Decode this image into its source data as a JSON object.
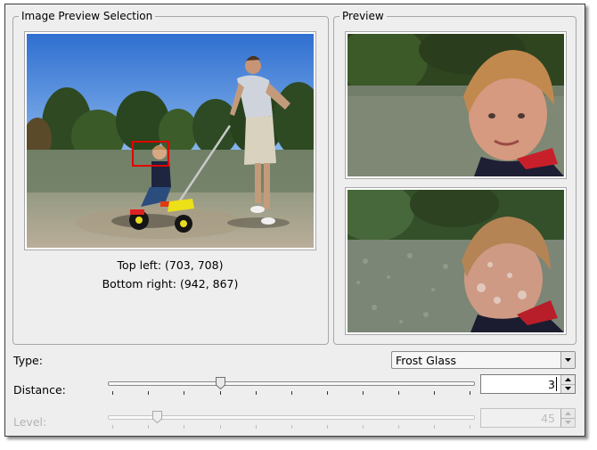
{
  "selection_panel": {
    "title": "Image Preview Selection",
    "top_left": "Top left: (703, 708)",
    "bottom_right": "Bottom right: (942, 867)"
  },
  "preview_panel": {
    "title": "Preview"
  },
  "controls": {
    "type_label": "Type:",
    "type_value": "Frost Glass",
    "distance_label": "Distance:",
    "distance_value": "3",
    "level_label": "Level:",
    "level_value": "45"
  },
  "icons": {
    "combo_arrow": "chevron-down-icon",
    "spin_up": "spin-up-icon",
    "spin_down": "spin-down-icon"
  },
  "colors": {
    "selection_rect": "#e00000",
    "dialog_bg": "#eeeeee",
    "disabled_text": "#b4b4b4"
  }
}
